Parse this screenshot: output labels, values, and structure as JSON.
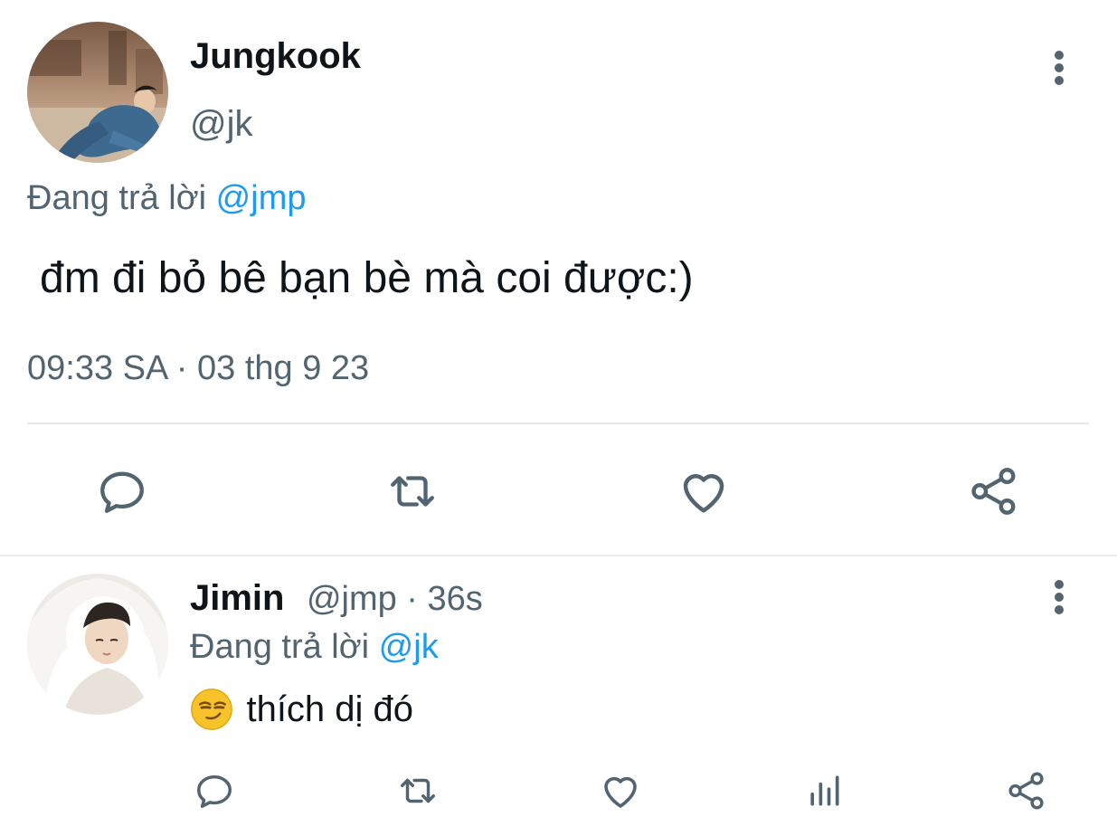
{
  "main_tweet": {
    "display_name": "Jungkook",
    "handle": "@jk",
    "replying_prefix": "Đang trả lời",
    "replying_to": "@jmp",
    "text": "đm đi bỏ bê bạn bè mà coi được:)",
    "timestamp": "09:33 SA · 03 thg 9 23",
    "avatar_icon": "profile-photo-jungkook",
    "actions": [
      "reply-icon",
      "retweet-icon",
      "like-icon",
      "share-icon"
    ]
  },
  "reply_tweet": {
    "display_name": "Jimin",
    "handle_time": "@jmp · 36s",
    "replying_prefix": "Đang trả lời",
    "replying_to": "@jk",
    "emoji_icon": "smirking-face-emoji",
    "text": "thích dị đó",
    "avatar_icon": "profile-photo-jimin",
    "actions": [
      "reply-icon",
      "retweet-icon",
      "like-icon",
      "analytics-icon",
      "share-icon"
    ]
  },
  "colors": {
    "text": "#0f1419",
    "muted": "#536471",
    "link": "#1d9bf0",
    "divider": "#e7e9ea",
    "icon": "#536471"
  }
}
